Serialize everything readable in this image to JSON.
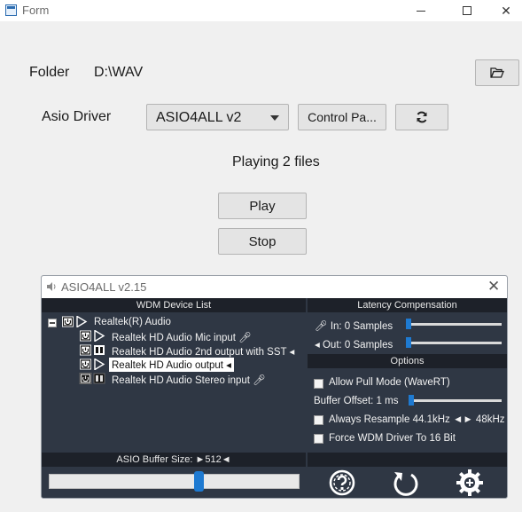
{
  "window": {
    "title": "Form"
  },
  "folder": {
    "label": "Folder",
    "path": "D:\\WAV"
  },
  "asio_driver": {
    "label": "Asio Driver",
    "selected": "ASIO4ALL v2",
    "control_panel_label": "Control Pa..."
  },
  "status": {
    "text": "Playing 2 files"
  },
  "actions": {
    "play_label": "Play",
    "stop_label": "Stop"
  },
  "asio_panel": {
    "title": "ASIO4ALL v2.15",
    "wdm_header": "WDM Device List",
    "latency_header": "Latency Compensation",
    "options_header": "Options",
    "devices": {
      "root": "Realtek(R) Audio",
      "items": [
        "Realtek HD Audio Mic input",
        "Realtek HD Audio 2nd output with SST",
        "Realtek HD Audio output",
        "Realtek HD Audio Stereo input"
      ]
    },
    "latency": {
      "in_label": "In: 0 Samples",
      "out_label": "Out: 0 Samples"
    },
    "options": {
      "allow_pull_mode": "Allow Pull Mode (WaveRT)",
      "buffer_offset": "Buffer Offset: 1 ms",
      "always_resample": "Always Resample 44.1kHz ◄► 48kHz",
      "force_wdm_16bit": "Force WDM Driver To 16 Bit"
    },
    "buffer_size_label": "ASIO Buffer Size: ►512◄",
    "buffer_size_level": 0.6
  },
  "colors": {
    "panel_bg": "#2f3744",
    "header_bg": "#1d2129",
    "accent": "#1e7ad1"
  }
}
